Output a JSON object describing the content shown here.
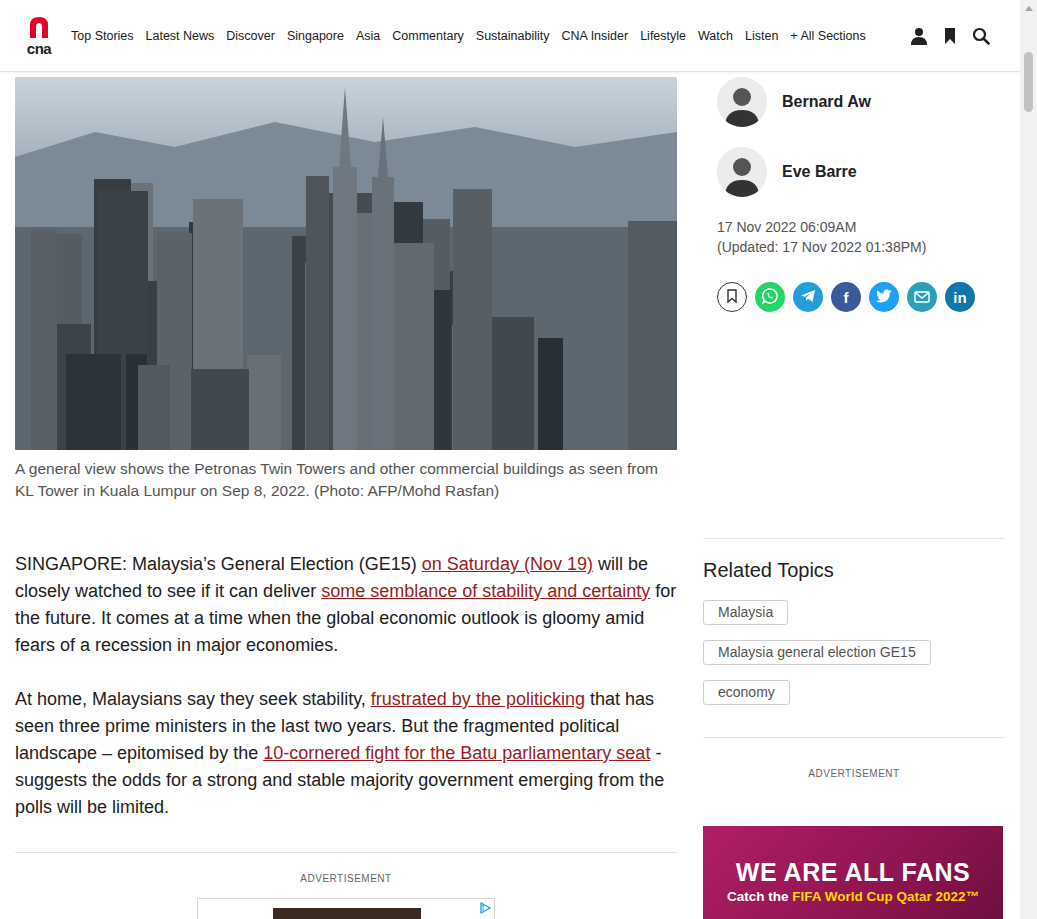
{
  "header": {
    "logo": "cna",
    "nav": [
      "Top Stories",
      "Latest News",
      "Discover",
      "Singapore",
      "Asia",
      "Commentary",
      "Sustainability",
      "CNA Insider",
      "Lifestyle",
      "Watch",
      "Listen",
      "+ All Sections"
    ]
  },
  "article": {
    "caption": "A general view shows the Petronas Twin Towers and other commercial buildings as seen from KL Tower in Kuala Lumpur on Sep 8, 2022. (Photo: AFP/Mohd Rasfan)",
    "paragraphs": [
      [
        {
          "text": "SINGAPORE: Malaysia’s General Election (GE15) ",
          "link": false
        },
        {
          "text": "on Saturday (Nov 19)",
          "link": true
        },
        {
          "text": " will be closely watched to see if it can deliver ",
          "link": false
        },
        {
          "text": "some semblance of stability and certainty",
          "link": true
        },
        {
          "text": " for the future. It comes at a time when the global economic outlook is gloomy amid fears of a recession in major economies.",
          "link": false
        }
      ],
      [
        {
          "text": "At home, Malaysians say they seek stability, ",
          "link": false
        },
        {
          "text": "frustrated by the politicking",
          "link": true
        },
        {
          "text": " that has seen three prime ministers in the last two years. But the fragmented political landscape – epitomised by the ",
          "link": false
        },
        {
          "text": "10-cornered fight for the Batu parliamentary seat",
          "link": true
        },
        {
          "text": " - suggests the odds for a strong and stable majority government emerging from the polls will be limited.",
          "link": false
        }
      ]
    ],
    "ad_label": "ADVERTISEMENT"
  },
  "sidebar": {
    "authors": [
      {
        "name": "Bernard Aw"
      },
      {
        "name": "Eve Barre"
      }
    ],
    "published": "17 Nov 2022 06:09AM",
    "updated": "(Updated: 17 Nov 2022 01:38PM)",
    "share": [
      {
        "kind": "bookmark",
        "color": "#ffffff"
      },
      {
        "kind": "whatsapp",
        "color": "#25d366"
      },
      {
        "kind": "telegram",
        "color": "#229ed9"
      },
      {
        "kind": "facebook",
        "color": "#3b5998",
        "glyph": "f"
      },
      {
        "kind": "twitter",
        "color": "#1da1f2"
      },
      {
        "kind": "email",
        "color": "#2a9fb8"
      },
      {
        "kind": "linkedin",
        "color": "#0e76a8",
        "glyph": "in"
      }
    ],
    "related_topics": {
      "title": "Related Topics",
      "tags": [
        "Malaysia",
        "Malaysia general election GE15",
        "economy"
      ]
    },
    "ad_label": "ADVERTISEMENT",
    "banner": {
      "headline": "WE ARE ALL FANS",
      "subline": [
        {
          "text": "Catch the ",
          "highlight": false
        },
        {
          "text": "FIFA World Cup Qatar 2022™",
          "highlight": true
        }
      ]
    }
  }
}
